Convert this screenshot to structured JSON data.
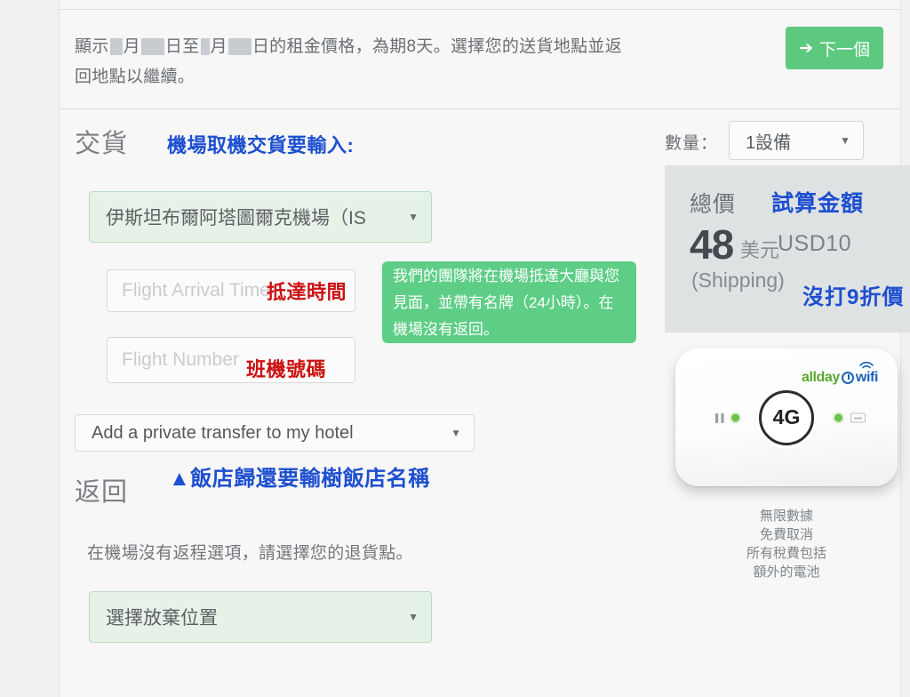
{
  "banner": {
    "text_part1": "顯示",
    "text_part2": "月",
    "text_part3": "日至",
    "text_part4": "月",
    "text_part5": "日的租金價格，為期8天。選擇您的送貨地點並返",
    "text_line2": "回地點以繼續。",
    "next_button": "下一個",
    "next_icon": "arrow-right-icon"
  },
  "delivery": {
    "title": "交貨",
    "annotation": "機場取機交貨要輸入:",
    "airport_value": "伊斯坦布爾阿塔圖爾克機場（IS",
    "flight_time_placeholder": "Flight Arrival Time",
    "flight_time_annotation": "抵達時間",
    "flight_number_placeholder": "Flight Number",
    "flight_number_annotation": "班機號碼",
    "tooltip": "我們的團隊將在機場抵達大廳與您見面，並帶有名牌（24小時）。在機場沒有返回。",
    "transfer_value": "Add a private transfer to my hotel"
  },
  "return": {
    "title": "返回",
    "annotation": "▲飯店歸還要輸樹飯店名稱",
    "note": "在機場沒有返程選項，請選擇您的退貨點。",
    "dropoff_value": "選擇放棄位置"
  },
  "sidebar_right": {
    "quantity_label": "數量：",
    "quantity_value": "1設備",
    "price": {
      "total_label": "總價",
      "annotation_estimate": "試算金額",
      "amount": "48",
      "currency_cn": "美元",
      "currency_usd": "USD10",
      "shipping": "(Shipping)",
      "annotation_discount": "沒打9折價"
    },
    "device": {
      "logo_allday": "allday",
      "logo_wifi": "wifi",
      "button_label": "4G"
    },
    "features": [
      "無限數據",
      "免費取消",
      "所有稅費包括",
      "額外的電池"
    ]
  },
  "colors": {
    "accent_green": "#5cc97f",
    "annotation_blue": "#1d4fd0",
    "annotation_red": "#cc1111",
    "field_green_bg": "#e6f2e7",
    "page_bg": "#f1f1f1"
  }
}
